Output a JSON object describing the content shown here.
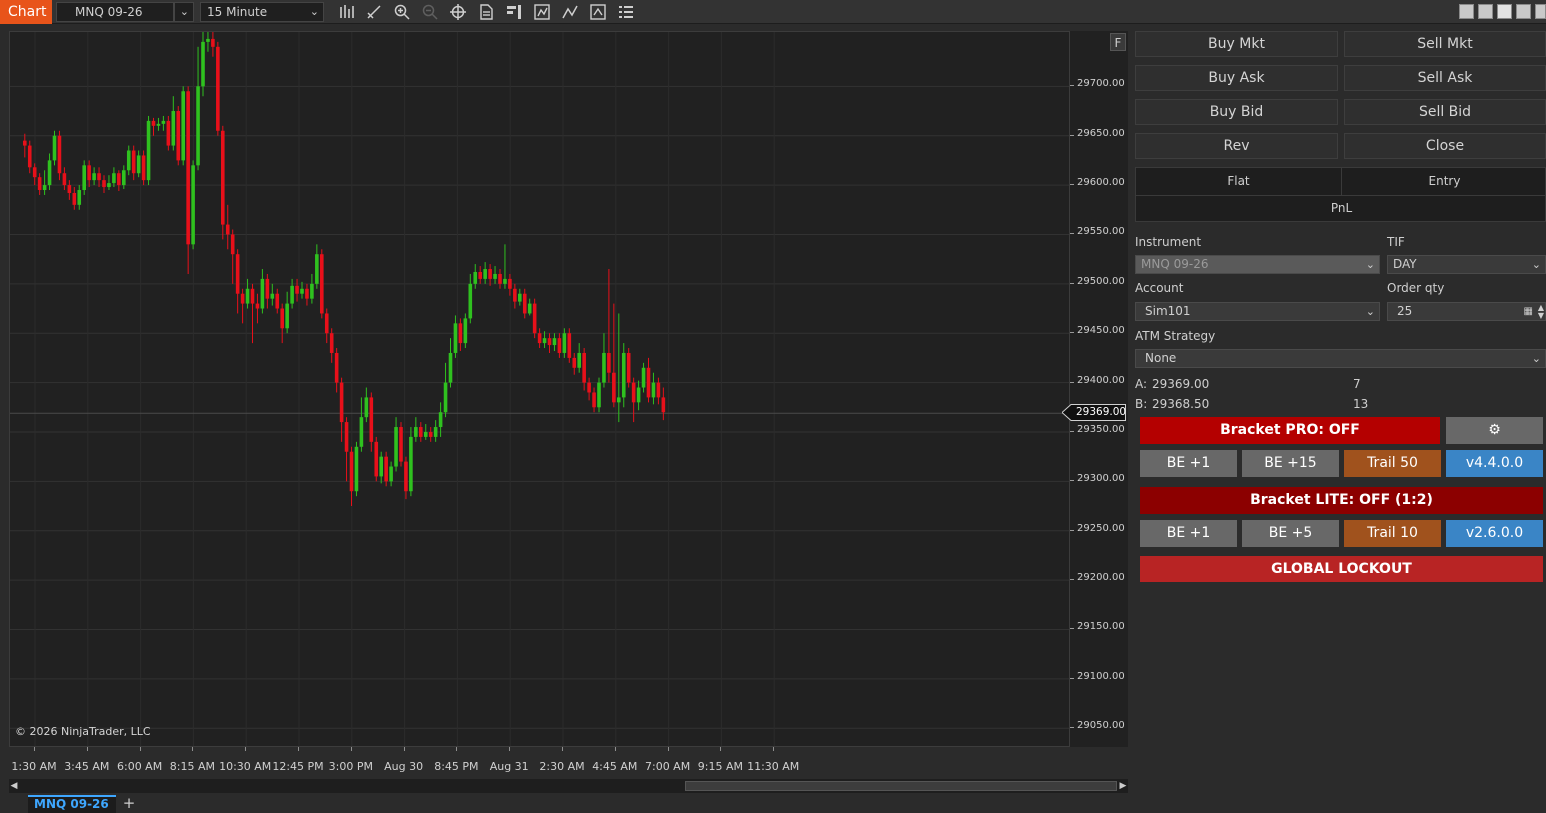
{
  "toolbar": {
    "tab_label": "Chart",
    "instrument": "MNQ 09-26",
    "interval": "15 Minute",
    "icons": [
      "bar-type-icon",
      "drawing-tools-icon",
      "zoom-in-icon",
      "zoom-out-icon",
      "crosshair-icon",
      "data-series-icon",
      "chart-trader-icon",
      "strategies-icon",
      "indicators-icon",
      "templates-icon",
      "properties-icon",
      "more-options-icon"
    ]
  },
  "chart": {
    "copyright": "© 2026 NinjaTrader, LLC",
    "y_ticks": [
      "29700.00",
      "29650.00",
      "29600.00",
      "29550.00",
      "29500.00",
      "29450.00",
      "29400.00",
      "29350.00",
      "29300.00",
      "29250.00",
      "29200.00",
      "29150.00",
      "29100.00",
      "29050.00"
    ],
    "x_ticks": [
      "1:30 AM",
      "3:45 AM",
      "6:00 AM",
      "8:15 AM",
      "10:30 AM",
      "12:45 PM",
      "3:00 PM",
      "Aug 30",
      "8:45 PM",
      "Aug 31",
      "2:30 AM",
      "4:45 AM",
      "7:00 AM",
      "9:15 AM",
      "11:30 AM"
    ],
    "last_price": "29369.00",
    "f_label": "F",
    "up_color": "#2fc11f",
    "down_color": "#e8101a"
  },
  "chart_data": {
    "type": "candlestick",
    "ylim": [
      29030,
      29755
    ],
    "last_price": 29369.0,
    "candles": [
      [
        29645,
        29640,
        29652,
        29628
      ],
      [
        29640,
        29618,
        29645,
        29612
      ],
      [
        29618,
        29608,
        29622,
        29600
      ],
      [
        29608,
        29595,
        29612,
        29590
      ],
      [
        29595,
        29600,
        29615,
        29590
      ],
      [
        29600,
        29625,
        29632,
        29595
      ],
      [
        29625,
        29650,
        29655,
        29620
      ],
      [
        29650,
        29612,
        29655,
        29605
      ],
      [
        29612,
        29600,
        29618,
        29595
      ],
      [
        29600,
        29592,
        29605,
        29585
      ],
      [
        29592,
        29580,
        29598,
        29575
      ],
      [
        29580,
        29595,
        29600,
        29575
      ],
      [
        29595,
        29620,
        29625,
        29590
      ],
      [
        29620,
        29605,
        29625,
        29598
      ],
      [
        29605,
        29612,
        29618,
        29600
      ],
      [
        29612,
        29605,
        29618,
        29598
      ],
      [
        29605,
        29598,
        29610,
        29592
      ],
      [
        29598,
        29602,
        29610,
        29595
      ],
      [
        29602,
        29612,
        29618,
        29598
      ],
      [
        29612,
        29600,
        29615,
        29594
      ],
      [
        29600,
        29615,
        29620,
        29596
      ],
      [
        29615,
        29635,
        29640,
        29610
      ],
      [
        29635,
        29612,
        29640,
        29605
      ],
      [
        29612,
        29630,
        29635,
        29608
      ],
      [
        29630,
        29605,
        29635,
        29600
      ],
      [
        29605,
        29665,
        29670,
        29600
      ],
      [
        29665,
        29660,
        29668,
        29650
      ],
      [
        29660,
        29662,
        29668,
        29655
      ],
      [
        29662,
        29665,
        29670,
        29655
      ],
      [
        29665,
        29640,
        29670,
        29635
      ],
      [
        29640,
        29675,
        29690,
        29635
      ],
      [
        29675,
        29625,
        29680,
        29620
      ],
      [
        29625,
        29695,
        29700,
        29620
      ],
      [
        29695,
        29540,
        29700,
        29510
      ],
      [
        29540,
        29620,
        29625,
        29535
      ],
      [
        29620,
        29700,
        29740,
        29615
      ],
      [
        29700,
        29745,
        29755,
        29690
      ],
      [
        29745,
        29748,
        29755,
        29735
      ],
      [
        29748,
        29740,
        29755,
        29730
      ],
      [
        29740,
        29655,
        29745,
        29650
      ],
      [
        29655,
        29560,
        29660,
        29545
      ],
      [
        29560,
        29550,
        29580,
        29535
      ],
      [
        29550,
        29530,
        29555,
        29500
      ],
      [
        29530,
        29490,
        29535,
        29470
      ],
      [
        29490,
        29480,
        29495,
        29460
      ],
      [
        29480,
        29495,
        29505,
        29475
      ],
      [
        29495,
        29480,
        29500,
        29440
      ],
      [
        29480,
        29475,
        29490,
        29460
      ],
      [
        29475,
        29505,
        29515,
        29470
      ],
      [
        29505,
        29485,
        29510,
        29475
      ],
      [
        29485,
        29490,
        29500,
        29478
      ],
      [
        29490,
        29475,
        29495,
        29470
      ],
      [
        29475,
        29455,
        29480,
        29440
      ],
      [
        29455,
        29480,
        29492,
        29450
      ],
      [
        29480,
        29498,
        29505,
        29475
      ],
      [
        29498,
        29490,
        29505,
        29482
      ],
      [
        29490,
        29495,
        29502,
        29485
      ],
      [
        29495,
        29485,
        29500,
        29478
      ],
      [
        29485,
        29500,
        29510,
        29480
      ],
      [
        29500,
        29530,
        29540,
        29495
      ],
      [
        29530,
        29470,
        29535,
        29465
      ],
      [
        29470,
        29450,
        29475,
        29440
      ],
      [
        29450,
        29430,
        29455,
        29420
      ],
      [
        29430,
        29400,
        29435,
        29390
      ],
      [
        29400,
        29360,
        29405,
        29340
      ],
      [
        29360,
        29330,
        29365,
        29300
      ],
      [
        29330,
        29290,
        29335,
        29275
      ],
      [
        29290,
        29335,
        29340,
        29285
      ],
      [
        29335,
        29365,
        29385,
        29330
      ],
      [
        29365,
        29385,
        29395,
        29360
      ],
      [
        29385,
        29340,
        29390,
        29330
      ],
      [
        29340,
        29305,
        29345,
        29300
      ],
      [
        29305,
        29325,
        29330,
        29298
      ],
      [
        29325,
        29300,
        29330,
        29295
      ],
      [
        29300,
        29315,
        29320,
        29295
      ],
      [
        29315,
        29355,
        29365,
        29310
      ],
      [
        29355,
        29320,
        29360,
        29315
      ],
      [
        29320,
        29290,
        29325,
        29282
      ],
      [
        29290,
        29345,
        29355,
        29285
      ],
      [
        29345,
        29355,
        29365,
        29340
      ],
      [
        29355,
        29345,
        29360,
        29340
      ],
      [
        29345,
        29350,
        29358,
        29342
      ],
      [
        29350,
        29345,
        29355,
        29340
      ],
      [
        29345,
        29355,
        29362,
        29340
      ],
      [
        29355,
        29370,
        29380,
        29345
      ],
      [
        29370,
        29400,
        29420,
        29365
      ],
      [
        29400,
        29430,
        29445,
        29395
      ],
      [
        29430,
        29460,
        29468,
        29425
      ],
      [
        29460,
        29440,
        29465,
        29432
      ],
      [
        29440,
        29465,
        29470,
        29435
      ],
      [
        29465,
        29500,
        29510,
        29460
      ],
      [
        29500,
        29512,
        29520,
        29495
      ],
      [
        29512,
        29505,
        29518,
        29500
      ],
      [
        29505,
        29515,
        29522,
        29500
      ],
      [
        29515,
        29505,
        29520,
        29498
      ],
      [
        29505,
        29510,
        29518,
        29500
      ],
      [
        29510,
        29500,
        29515,
        29495
      ],
      [
        29500,
        29505,
        29540,
        29495
      ],
      [
        29505,
        29495,
        29510,
        29488
      ],
      [
        29495,
        29482,
        29500,
        29475
      ],
      [
        29482,
        29490,
        29495,
        29478
      ],
      [
        29490,
        29470,
        29495,
        29465
      ],
      [
        29470,
        29480,
        29485,
        29468
      ],
      [
        29480,
        29450,
        29485,
        29445
      ],
      [
        29450,
        29440,
        29455,
        29435
      ],
      [
        29440,
        29445,
        29452,
        29435
      ],
      [
        29445,
        29438,
        29450,
        29430
      ],
      [
        29438,
        29445,
        29450,
        29432
      ],
      [
        29445,
        29430,
        29450,
        29425
      ],
      [
        29430,
        29450,
        29455,
        29425
      ],
      [
        29450,
        29425,
        29455,
        29420
      ],
      [
        29425,
        29415,
        29430,
        29408
      ],
      [
        29415,
        29430,
        29440,
        29410
      ],
      [
        29430,
        29400,
        29435,
        29392
      ],
      [
        29400,
        29390,
        29405,
        29382
      ],
      [
        29390,
        29375,
        29395,
        29370
      ],
      [
        29375,
        29400,
        29405,
        29370
      ],
      [
        29400,
        29430,
        29450,
        29395
      ],
      [
        29430,
        29410,
        29515,
        29400
      ],
      [
        29410,
        29380,
        29480,
        29375
      ],
      [
        29380,
        29385,
        29470,
        29360
      ],
      [
        29385,
        29430,
        29440,
        29375
      ],
      [
        29430,
        29400,
        29435,
        29395
      ],
      [
        29400,
        29380,
        29405,
        29360
      ],
      [
        29380,
        29395,
        29402,
        29372
      ],
      [
        29395,
        29415,
        29420,
        29390
      ],
      [
        29415,
        29385,
        29425,
        29380
      ],
      [
        29385,
        29400,
        29410,
        29378
      ],
      [
        29400,
        29385,
        29405,
        29378
      ],
      [
        29385,
        29370,
        29395,
        29362
      ]
    ]
  },
  "panel": {
    "buy_mkt": "Buy Mkt",
    "sell_mkt": "Sell Mkt",
    "buy_ask": "Buy Ask",
    "sell_ask": "Sell Ask",
    "buy_bid": "Buy Bid",
    "sell_bid": "Sell Bid",
    "rev": "Rev",
    "close": "Close",
    "position": {
      "flat": "Flat",
      "entry": "Entry",
      "pnl": "PnL"
    },
    "instrument_label": "Instrument",
    "instrument_value": "MNQ 09-26",
    "tif_label": "TIF",
    "tif_value": "DAY",
    "account_label": "Account",
    "account_value": "Sim101",
    "order_qty_label": "Order qty",
    "order_qty_value": "25",
    "atm_label": "ATM Strategy",
    "atm_value": "None",
    "ask_label": "A:",
    "ask_price": "29369.00",
    "ask_size": "7",
    "bid_label": "B:",
    "bid_price": "29368.50",
    "bid_size": "13",
    "bracket_pro": "Bracket PRO: OFF",
    "pro_be1": "BE +1",
    "pro_be15": "BE +15",
    "pro_trail": "Trail 50",
    "pro_version": "v4.4.0.0",
    "bracket_lite": "Bracket LITE: OFF (1:2)",
    "lite_be1": "BE +1",
    "lite_be5": "BE +5",
    "lite_trail": "Trail 10",
    "lite_version": "v2.6.0.0",
    "global_lockout": "GLOBAL LOCKOUT",
    "colors": {
      "bracket_pro": "#b40000",
      "bracket_lite": "#8c0000",
      "lockout": "#b82424",
      "trail": "#a0521d",
      "version": "#3a85c6",
      "be": "#686868"
    }
  },
  "tabs": {
    "instrument_tab": "MNQ 09-26",
    "add": "+"
  }
}
